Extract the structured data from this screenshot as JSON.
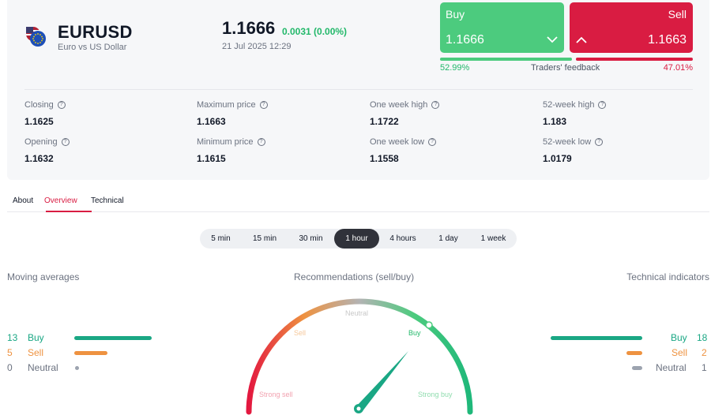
{
  "instrument": {
    "symbol": "EURUSD",
    "name": "Euro vs US Dollar",
    "price": "1.1666",
    "change": "0.0031 (0.00%)",
    "datetime": "21 Jul 2025 12:29"
  },
  "trade": {
    "buy_label": "Buy",
    "buy_price": "1.1666",
    "sell_label": "Sell",
    "sell_price": "1.1663"
  },
  "feedback": {
    "label": "Traders' feedback",
    "buy_pct": "52.99%",
    "sell_pct": "47.01%",
    "buy_fraction": 0.5299
  },
  "stats": [
    {
      "label": "Closing",
      "value": "1.1625"
    },
    {
      "label": "Maximum price",
      "value": "1.1663"
    },
    {
      "label": "One week high",
      "value": "1.1722"
    },
    {
      "label": "52-week high",
      "value": "1.183"
    },
    {
      "label": "Opening",
      "value": "1.1632"
    },
    {
      "label": "Minimum price",
      "value": "1.1615"
    },
    {
      "label": "One week low",
      "value": "1.1558"
    },
    {
      "label": "52-week low",
      "value": "1.0179"
    }
  ],
  "tabs": [
    "About",
    "Overview",
    "Technical"
  ],
  "active_tab": "Overview",
  "timeframes": [
    "5 min",
    "15 min",
    "30 min",
    "1 hour",
    "4 hours",
    "1 day",
    "1 week"
  ],
  "active_timeframe": "1 hour",
  "moving_averages": {
    "title": "Moving averages",
    "rows": [
      {
        "count": "13",
        "label": "Buy"
      },
      {
        "count": "5",
        "label": "Sell"
      },
      {
        "count": "0",
        "label": "Neutral"
      }
    ]
  },
  "recommendations": {
    "title": "Recommendations (sell/buy)",
    "labels": {
      "strong_sell": "Strong sell",
      "sell": "Sell",
      "neutral": "Neutral",
      "buy": "Buy",
      "strong_buy": "Strong buy"
    }
  },
  "technical_indicators": {
    "title": "Technical indicators",
    "rows": [
      {
        "count": "18",
        "label": "Buy"
      },
      {
        "count": "2",
        "label": "Sell"
      },
      {
        "count": "1",
        "label": "Neutral"
      }
    ]
  },
  "colors": {
    "buy": "#4ccb7e",
    "sell": "#d91c42",
    "ma_buy": "#1aa784",
    "ma_sell": "#ee9240",
    "neutral": "#9ca3af"
  }
}
